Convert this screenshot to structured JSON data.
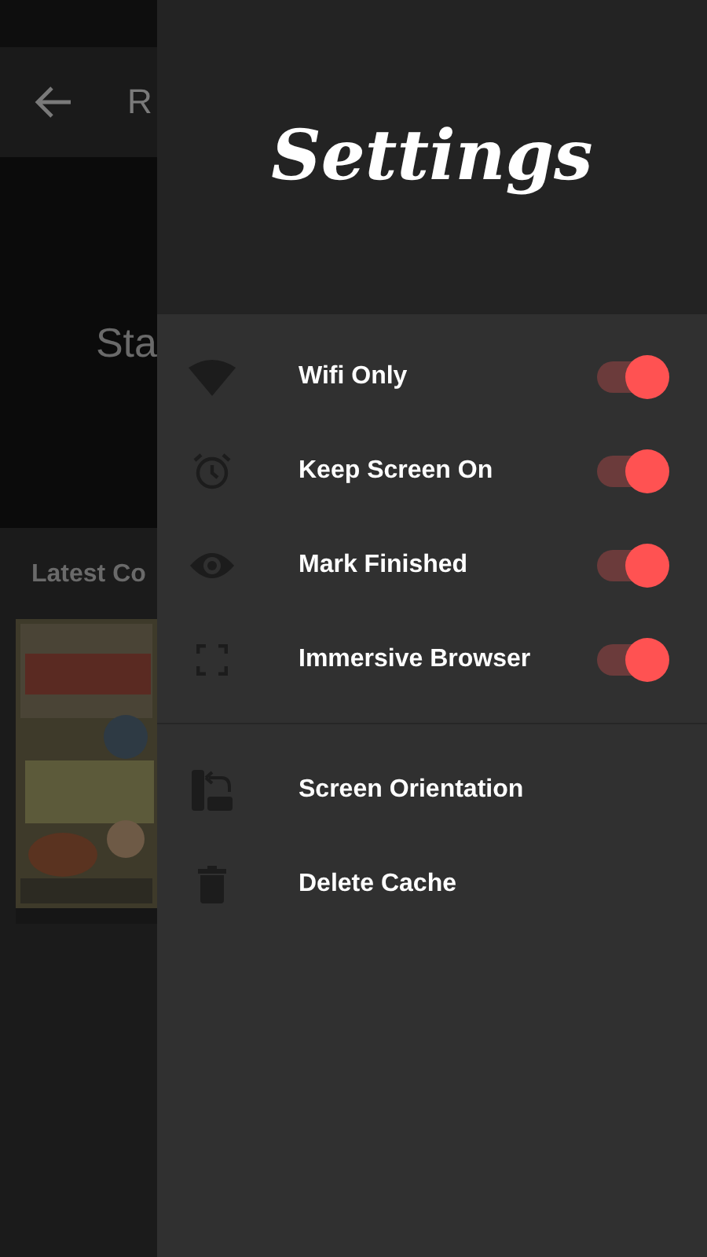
{
  "background": {
    "app_bar_title": "R",
    "banner_text": "Sta",
    "section_title": "Latest Co"
  },
  "drawer": {
    "title": "Settings",
    "toggles": [
      {
        "label": "Wifi Only",
        "on": true
      },
      {
        "label": "Keep Screen On",
        "on": true
      },
      {
        "label": "Mark Finished",
        "on": true
      },
      {
        "label": "Immersive Browser",
        "on": true
      }
    ],
    "actions": [
      {
        "label": "Screen Orientation"
      },
      {
        "label": "Delete Cache"
      }
    ]
  }
}
